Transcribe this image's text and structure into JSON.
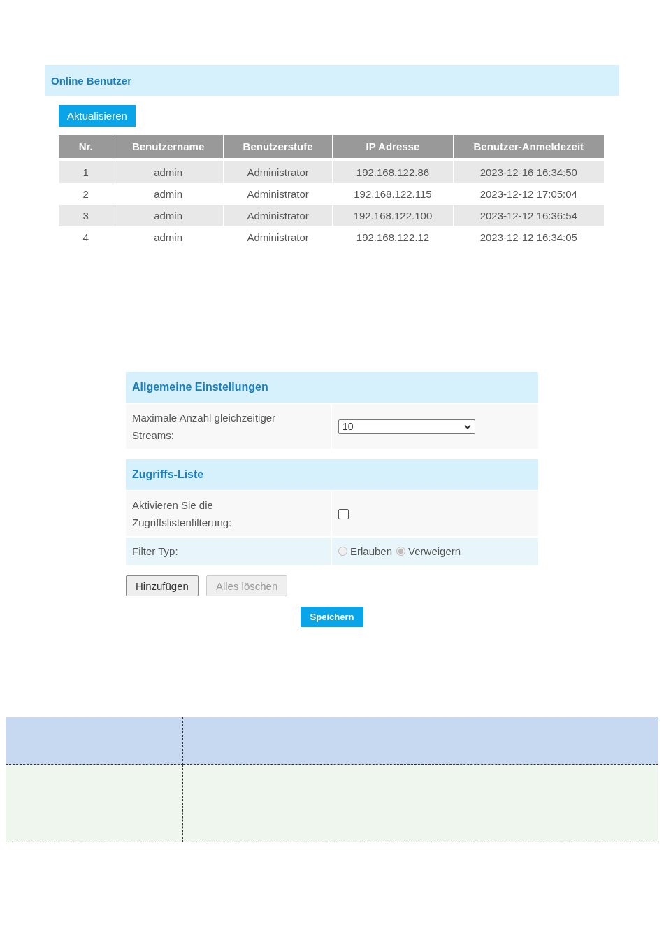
{
  "online_users": {
    "title": "Online Benutzer",
    "refresh_button": "Aktualisieren",
    "table": {
      "columns": [
        "Nr.",
        "Benutzername",
        "Benutzerstufe",
        "IP Adresse",
        "Benutzer-Anmeldezeit"
      ],
      "rows": [
        {
          "cells": [
            "1",
            "admin",
            "Administrator",
            "192.168.122.86",
            "2023-12-16 16:34:50"
          ]
        },
        {
          "cells": [
            "2",
            "admin",
            "Administrator",
            "192.168.122.115",
            "2023-12-12 17:05:04"
          ]
        },
        {
          "cells": [
            "3",
            "admin",
            "Administrator",
            "192.168.122.100",
            "2023-12-12 16:36:54"
          ]
        },
        {
          "cells": [
            "4",
            "admin",
            "Administrator",
            "192.168.122.12",
            "2023-12-12 16:34:05"
          ]
        }
      ]
    }
  },
  "settings": {
    "sections": [
      {
        "title": "Allgemeine Einstellungen",
        "rows": [
          {
            "kind": "select",
            "label": "Maximale Anzahl gleichzeitiger Streams:",
            "value": "10"
          }
        ]
      },
      {
        "title": "Zugriffs-Liste",
        "rows": [
          {
            "kind": "checkbox",
            "label": "Aktivieren Sie die Zugriffslistenfilterung:",
            "checked": false
          },
          {
            "kind": "radio",
            "label": "Filter Typ:",
            "disabled": true,
            "options": [
              {
                "label": "Erlauben",
                "selected": false
              },
              {
                "label": "Verweigern",
                "selected": true
              }
            ]
          }
        ]
      }
    ],
    "buttons": [
      {
        "label": "Hinzufügen",
        "disabled": false
      },
      {
        "label": "Alles löschen",
        "disabled": true
      }
    ],
    "save_button": "Speichern"
  }
}
